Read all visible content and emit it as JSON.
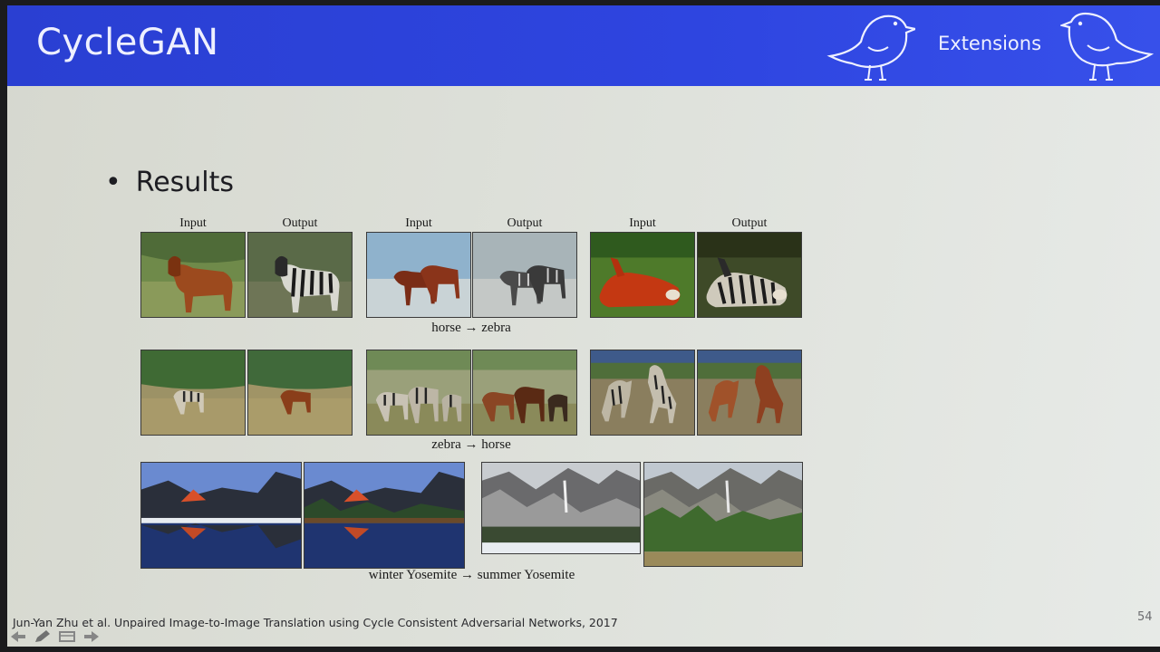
{
  "header": {
    "title": "CycleGAN",
    "section": "Extensions",
    "accent_color": "#2e45e0",
    "icons": [
      "bird-icon",
      "bird-icon"
    ]
  },
  "content": {
    "bullet": "Results",
    "column_labels": [
      "Input",
      "Output",
      "Input",
      "Output",
      "Input",
      "Output"
    ],
    "captions": {
      "horse_zebra": "horse → zebra",
      "zebra_horse": "zebra → horse",
      "yosemite": "winter Yosemite → summer Yosemite"
    }
  },
  "footer": {
    "citation": "Jun-Yan Zhu et al. Unpaired Image-to-Image Translation using Cycle Consistent Adversarial Networks, 2017",
    "page_number": "54",
    "nav_icons": [
      "prev-icon",
      "pen-icon",
      "screen-icon",
      "next-icon"
    ]
  }
}
